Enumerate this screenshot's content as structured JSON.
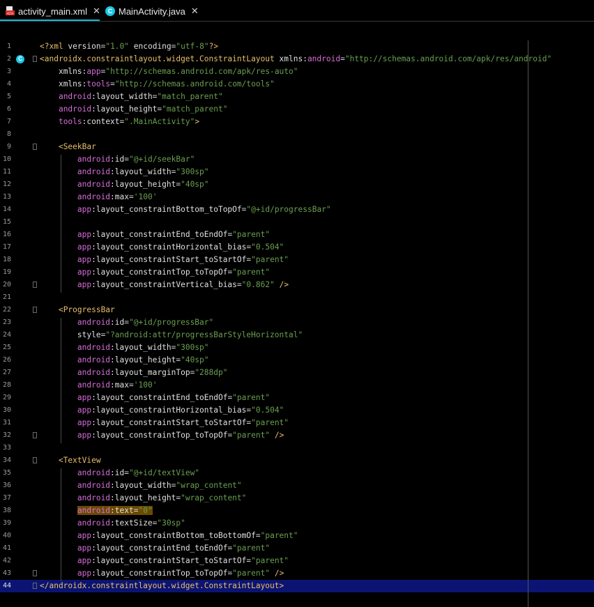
{
  "tabs": [
    {
      "label": "activity_main.xml",
      "icon": "xml-file-icon",
      "active": true
    },
    {
      "label": "MainActivity.java",
      "icon": "java-class-icon",
      "active": false
    }
  ],
  "close_glyph": "✕",
  "gutter_icon_letter": "C",
  "lines": [
    {
      "n": "1",
      "t": [
        [
          "tag",
          "<?xml "
        ],
        [
          "attr",
          "version"
        ],
        [
          "plain",
          "="
        ],
        [
          "val",
          "\"1.0\""
        ],
        [
          "plain",
          " "
        ],
        [
          "attr",
          "encoding"
        ],
        [
          "plain",
          "="
        ],
        [
          "val",
          "\"utf-8\""
        ],
        [
          "tag",
          "?>"
        ]
      ]
    },
    {
      "n": "2",
      "t": [
        [
          "tag",
          "<androidx.constraintlayout.widget.ConstraintLayout "
        ],
        [
          "attr",
          "xmlns:"
        ],
        [
          "ns",
          "android"
        ],
        [
          "plain",
          "="
        ],
        [
          "val",
          "\"http://schemas.android.com/apk/res/android\""
        ]
      ]
    },
    {
      "n": "3",
      "t": [
        [
          "plain",
          "    "
        ],
        [
          "attr",
          "xmlns:"
        ],
        [
          "ns",
          "app"
        ],
        [
          "plain",
          "="
        ],
        [
          "val",
          "\"http://schemas.android.com/apk/res-auto\""
        ]
      ]
    },
    {
      "n": "4",
      "t": [
        [
          "plain",
          "    "
        ],
        [
          "attr",
          "xmlns:"
        ],
        [
          "ns",
          "tools"
        ],
        [
          "plain",
          "="
        ],
        [
          "val",
          "\"http://schemas.android.com/tools\""
        ]
      ]
    },
    {
      "n": "5",
      "t": [
        [
          "plain",
          "    "
        ],
        [
          "ns",
          "android"
        ],
        [
          "attr",
          ":layout_width"
        ],
        [
          "plain",
          "="
        ],
        [
          "val",
          "\"match_parent\""
        ]
      ]
    },
    {
      "n": "6",
      "t": [
        [
          "plain",
          "    "
        ],
        [
          "ns",
          "android"
        ],
        [
          "attr",
          ":layout_height"
        ],
        [
          "plain",
          "="
        ],
        [
          "val",
          "\"match_parent\""
        ]
      ]
    },
    {
      "n": "7",
      "t": [
        [
          "plain",
          "    "
        ],
        [
          "ns",
          "tools"
        ],
        [
          "attr",
          ":context"
        ],
        [
          "plain",
          "="
        ],
        [
          "val",
          "\".MainActivity\""
        ],
        [
          "tag",
          ">"
        ]
      ]
    },
    {
      "n": "8",
      "t": []
    },
    {
      "n": "9",
      "t": [
        [
          "plain",
          "    "
        ],
        [
          "tag",
          "<SeekBar"
        ]
      ]
    },
    {
      "n": "10",
      "t": [
        [
          "plain",
          "        "
        ],
        [
          "ns",
          "android"
        ],
        [
          "attr",
          ":id"
        ],
        [
          "plain",
          "="
        ],
        [
          "val",
          "\"@+id/seekBar\""
        ]
      ]
    },
    {
      "n": "11",
      "t": [
        [
          "plain",
          "        "
        ],
        [
          "ns",
          "android"
        ],
        [
          "attr",
          ":layout_width"
        ],
        [
          "plain",
          "="
        ],
        [
          "val",
          "\"300sp\""
        ]
      ]
    },
    {
      "n": "12",
      "t": [
        [
          "plain",
          "        "
        ],
        [
          "ns",
          "android"
        ],
        [
          "attr",
          ":layout_height"
        ],
        [
          "plain",
          "="
        ],
        [
          "val",
          "\"40sp\""
        ]
      ]
    },
    {
      "n": "13",
      "t": [
        [
          "plain",
          "        "
        ],
        [
          "ns",
          "android"
        ],
        [
          "attr",
          ":max"
        ],
        [
          "plain",
          "="
        ],
        [
          "val",
          "'100'"
        ]
      ]
    },
    {
      "n": "14",
      "t": [
        [
          "plain",
          "        "
        ],
        [
          "ns",
          "app"
        ],
        [
          "attr",
          ":layout_constraintBottom_toTopOf"
        ],
        [
          "plain",
          "="
        ],
        [
          "val",
          "\"@+id/progressBar\""
        ]
      ]
    },
    {
      "n": "15",
      "t": []
    },
    {
      "n": "16",
      "t": [
        [
          "plain",
          "        "
        ],
        [
          "ns",
          "app"
        ],
        [
          "attr",
          ":layout_constraintEnd_toEndOf"
        ],
        [
          "plain",
          "="
        ],
        [
          "val",
          "\"parent\""
        ]
      ]
    },
    {
      "n": "17",
      "t": [
        [
          "plain",
          "        "
        ],
        [
          "ns",
          "app"
        ],
        [
          "attr",
          ":layout_constraintHorizontal_bias"
        ],
        [
          "plain",
          "="
        ],
        [
          "val",
          "\"0.504\""
        ]
      ]
    },
    {
      "n": "18",
      "t": [
        [
          "plain",
          "        "
        ],
        [
          "ns",
          "app"
        ],
        [
          "attr",
          ":layout_constraintStart_toStartOf"
        ],
        [
          "plain",
          "="
        ],
        [
          "val",
          "\"parent\""
        ]
      ]
    },
    {
      "n": "19",
      "t": [
        [
          "plain",
          "        "
        ],
        [
          "ns",
          "app"
        ],
        [
          "attr",
          ":layout_constraintTop_toTopOf"
        ],
        [
          "plain",
          "="
        ],
        [
          "val",
          "\"parent\""
        ]
      ]
    },
    {
      "n": "20",
      "t": [
        [
          "plain",
          "        "
        ],
        [
          "ns",
          "app"
        ],
        [
          "attr",
          ":layout_constraintVertical_bias"
        ],
        [
          "plain",
          "="
        ],
        [
          "val",
          "\"0.862\""
        ],
        [
          "plain",
          " "
        ],
        [
          "tag",
          "/>"
        ]
      ]
    },
    {
      "n": "21",
      "t": []
    },
    {
      "n": "22",
      "t": [
        [
          "plain",
          "    "
        ],
        [
          "tag",
          "<ProgressBar"
        ]
      ]
    },
    {
      "n": "23",
      "t": [
        [
          "plain",
          "        "
        ],
        [
          "ns",
          "android"
        ],
        [
          "attr",
          ":id"
        ],
        [
          "plain",
          "="
        ],
        [
          "val",
          "\"@+id/progressBar\""
        ]
      ]
    },
    {
      "n": "24",
      "t": [
        [
          "plain",
          "        "
        ],
        [
          "attr",
          "style"
        ],
        [
          "plain",
          "="
        ],
        [
          "val",
          "\"?android:attr/progressBarStyleHorizontal\""
        ]
      ]
    },
    {
      "n": "25",
      "t": [
        [
          "plain",
          "        "
        ],
        [
          "ns",
          "android"
        ],
        [
          "attr",
          ":layout_width"
        ],
        [
          "plain",
          "="
        ],
        [
          "val",
          "\"300sp\""
        ]
      ]
    },
    {
      "n": "26",
      "t": [
        [
          "plain",
          "        "
        ],
        [
          "ns",
          "android"
        ],
        [
          "attr",
          ":layout_height"
        ],
        [
          "plain",
          "="
        ],
        [
          "val",
          "\"40sp\""
        ]
      ]
    },
    {
      "n": "27",
      "t": [
        [
          "plain",
          "        "
        ],
        [
          "ns",
          "android"
        ],
        [
          "attr",
          ":layout_marginTop"
        ],
        [
          "plain",
          "="
        ],
        [
          "val",
          "\"288dp\""
        ]
      ]
    },
    {
      "n": "28",
      "t": [
        [
          "plain",
          "        "
        ],
        [
          "ns",
          "android"
        ],
        [
          "attr",
          ":max"
        ],
        [
          "plain",
          "="
        ],
        [
          "val",
          "'100'"
        ]
      ]
    },
    {
      "n": "29",
      "t": [
        [
          "plain",
          "        "
        ],
        [
          "ns",
          "app"
        ],
        [
          "attr",
          ":layout_constraintEnd_toEndOf"
        ],
        [
          "plain",
          "="
        ],
        [
          "val",
          "\"parent\""
        ]
      ]
    },
    {
      "n": "30",
      "t": [
        [
          "plain",
          "        "
        ],
        [
          "ns",
          "app"
        ],
        [
          "attr",
          ":layout_constraintHorizontal_bias"
        ],
        [
          "plain",
          "="
        ],
        [
          "val",
          "\"0.504\""
        ]
      ]
    },
    {
      "n": "31",
      "t": [
        [
          "plain",
          "        "
        ],
        [
          "ns",
          "app"
        ],
        [
          "attr",
          ":layout_constraintStart_toStartOf"
        ],
        [
          "plain",
          "="
        ],
        [
          "val",
          "\"parent\""
        ]
      ]
    },
    {
      "n": "32",
      "t": [
        [
          "plain",
          "        "
        ],
        [
          "ns",
          "app"
        ],
        [
          "attr",
          ":layout_constraintTop_toTopOf"
        ],
        [
          "plain",
          "="
        ],
        [
          "val",
          "\"parent\""
        ],
        [
          "plain",
          " "
        ],
        [
          "tag",
          "/>"
        ]
      ]
    },
    {
      "n": "33",
      "t": []
    },
    {
      "n": "34",
      "t": [
        [
          "plain",
          "    "
        ],
        [
          "tag",
          "<TextView"
        ]
      ]
    },
    {
      "n": "35",
      "t": [
        [
          "plain",
          "        "
        ],
        [
          "ns",
          "android"
        ],
        [
          "attr",
          ":id"
        ],
        [
          "plain",
          "="
        ],
        [
          "val",
          "\"@+id/textView\""
        ]
      ]
    },
    {
      "n": "36",
      "t": [
        [
          "plain",
          "        "
        ],
        [
          "ns",
          "android"
        ],
        [
          "attr",
          ":layout_width"
        ],
        [
          "plain",
          "="
        ],
        [
          "val",
          "\"wrap_content\""
        ]
      ]
    },
    {
      "n": "37",
      "t": [
        [
          "plain",
          "        "
        ],
        [
          "ns",
          "android"
        ],
        [
          "attr",
          ":layout_height"
        ],
        [
          "plain",
          "="
        ],
        [
          "val",
          "\"wrap_content\""
        ]
      ]
    },
    {
      "n": "38",
      "hl": true,
      "t": [
        [
          "plain",
          "        "
        ],
        [
          "ns",
          "android"
        ],
        [
          "attr",
          ":text"
        ],
        [
          "plain",
          "="
        ],
        [
          "val",
          "\"0\""
        ]
      ]
    },
    {
      "n": "39",
      "t": [
        [
          "plain",
          "        "
        ],
        [
          "ns",
          "android"
        ],
        [
          "attr",
          ":textSize"
        ],
        [
          "plain",
          "="
        ],
        [
          "val",
          "\"30sp\""
        ]
      ]
    },
    {
      "n": "40",
      "t": [
        [
          "plain",
          "        "
        ],
        [
          "ns",
          "app"
        ],
        [
          "attr",
          ":layout_constraintBottom_toBottomOf"
        ],
        [
          "plain",
          "="
        ],
        [
          "val",
          "\"parent\""
        ]
      ]
    },
    {
      "n": "41",
      "t": [
        [
          "plain",
          "        "
        ],
        [
          "ns",
          "app"
        ],
        [
          "attr",
          ":layout_constraintEnd_toEndOf"
        ],
        [
          "plain",
          "="
        ],
        [
          "val",
          "\"parent\""
        ]
      ]
    },
    {
      "n": "42",
      "t": [
        [
          "plain",
          "        "
        ],
        [
          "ns",
          "app"
        ],
        [
          "attr",
          ":layout_constraintStart_toStartOf"
        ],
        [
          "plain",
          "="
        ],
        [
          "val",
          "\"parent\""
        ]
      ]
    },
    {
      "n": "43",
      "t": [
        [
          "plain",
          "        "
        ],
        [
          "ns",
          "app"
        ],
        [
          "attr",
          ":layout_constraintTop_toTopOf"
        ],
        [
          "plain",
          "="
        ],
        [
          "val",
          "\"parent\""
        ],
        [
          "plain",
          " "
        ],
        [
          "tag",
          "/>"
        ]
      ]
    },
    {
      "n": "44",
      "current": true,
      "t": [
        [
          "tag",
          "</androidx.constraintlayout.widget.ConstraintLayout>"
        ]
      ]
    }
  ]
}
